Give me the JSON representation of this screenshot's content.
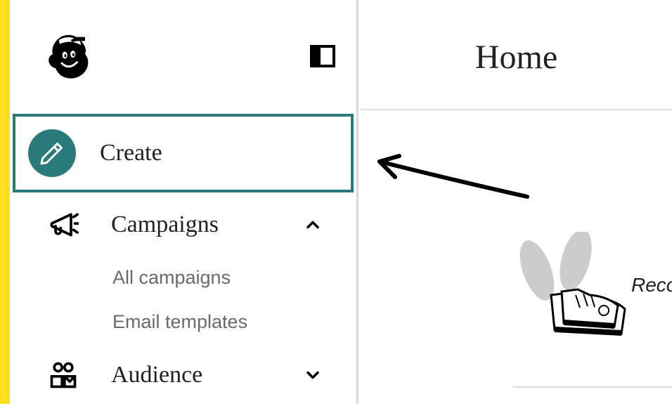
{
  "page_title": "Home",
  "sidebar": {
    "create_label": "Create",
    "campaigns": {
      "label": "Campaigns",
      "expanded": true,
      "sub": [
        "All campaigns",
        "Email templates"
      ]
    },
    "audience": {
      "label": "Audience",
      "expanded": false
    }
  },
  "main": {
    "reco_partial": "Reco"
  }
}
